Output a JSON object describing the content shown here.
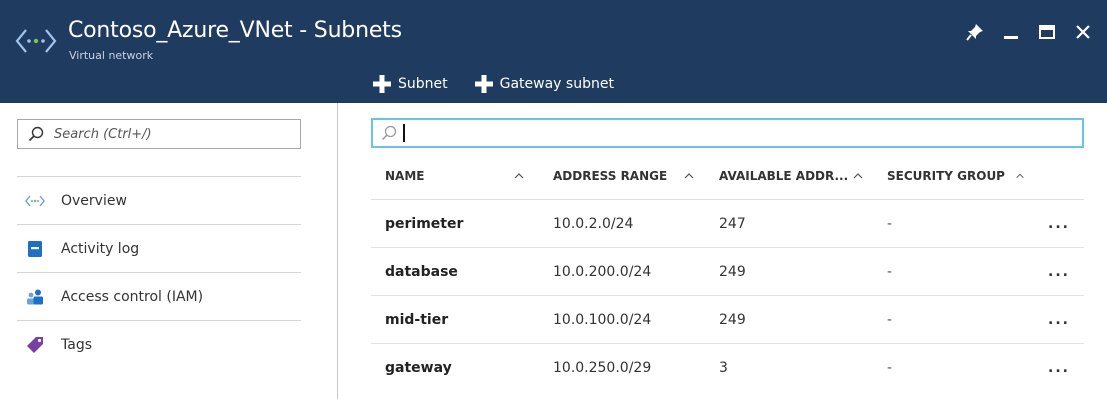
{
  "header": {
    "title": "Contoso_Azure_VNet - Subnets",
    "subtitle": "Virtual network",
    "logo_icon": "vnet-icon",
    "background": "#1f3b60"
  },
  "window_controls": {
    "pin_icon": "pin-icon",
    "minimize_icon": "minimize-icon",
    "maximize_icon": "maximize-icon",
    "close_icon": "close-icon"
  },
  "command_bar": {
    "add_subnet_label": "Subnet",
    "add_gateway_subnet_label": "Gateway subnet"
  },
  "sidebar": {
    "search_placeholder": "Search (Ctrl+/)",
    "items": [
      {
        "label": "Overview",
        "icon": "vnet-icon"
      },
      {
        "label": "Activity log",
        "icon": "activity-log-icon"
      },
      {
        "label": "Access control (IAM)",
        "icon": "iam-icon"
      },
      {
        "label": "Tags",
        "icon": "tag-icon"
      }
    ]
  },
  "filter": {
    "value": "",
    "accent": "#69c3e6"
  },
  "grid": {
    "columns": [
      "NAME",
      "ADDRESS RANGE",
      "AVAILABLE ADDR...",
      "SECURITY GROUP"
    ],
    "rows": [
      {
        "name": "perimeter",
        "address_range": "10.0.2.0/24",
        "available": "247",
        "security_group": "-",
        "more": "..."
      },
      {
        "name": "database",
        "address_range": "10.0.200.0/24",
        "available": "249",
        "security_group": "-",
        "more": "..."
      },
      {
        "name": "mid-tier",
        "address_range": "10.0.100.0/24",
        "available": "249",
        "security_group": "-",
        "more": "..."
      },
      {
        "name": "gateway",
        "address_range": "10.0.250.0/29",
        "available": "3",
        "security_group": "-",
        "more": "..."
      }
    ]
  }
}
